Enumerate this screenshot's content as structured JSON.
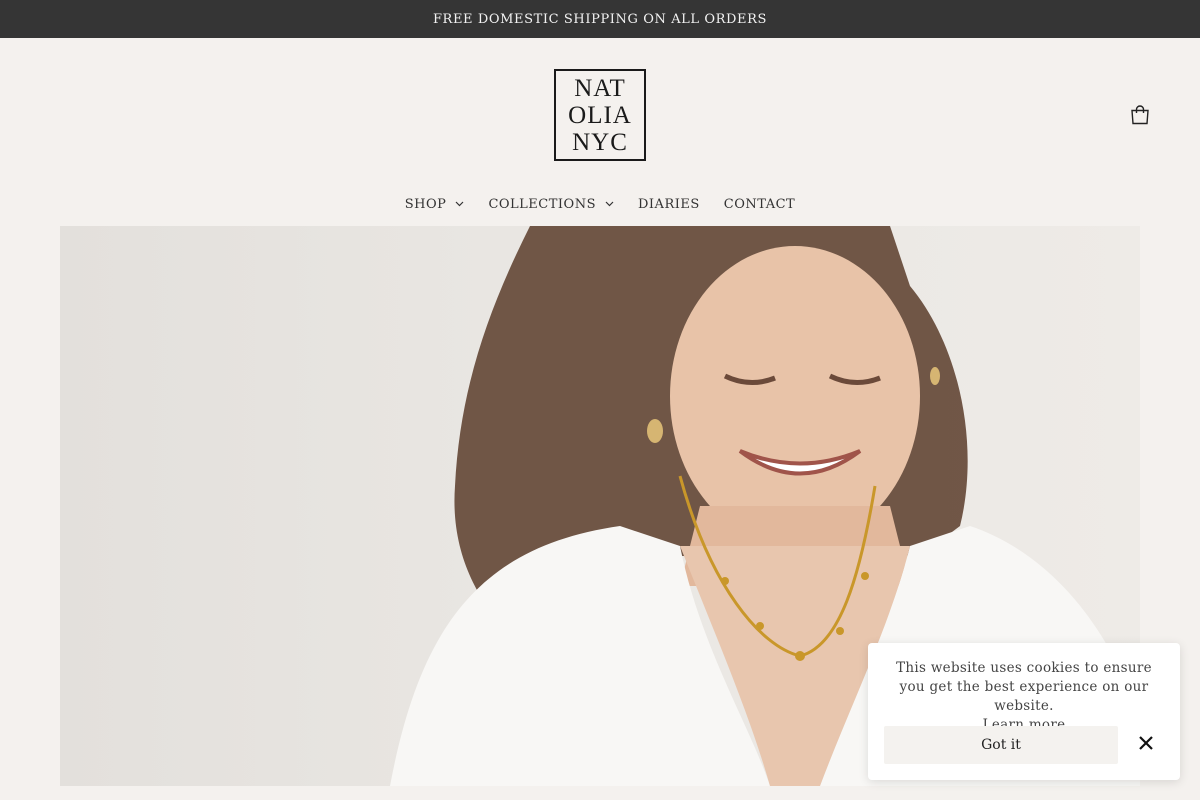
{
  "announcement": {
    "text": "FREE DOMESTIC SHIPPING ON ALL ORDERS"
  },
  "header": {
    "logo_lines": [
      "NAT",
      "OLIA",
      "NYC"
    ],
    "cart_icon": "shopping-bag-icon"
  },
  "nav": {
    "items": [
      {
        "label": "SHOP",
        "has_dropdown": true
      },
      {
        "label": "COLLECTIONS",
        "has_dropdown": true
      },
      {
        "label": "DIARIES",
        "has_dropdown": false
      },
      {
        "label": "CONTACT",
        "has_dropdown": false
      }
    ]
  },
  "cookie": {
    "message": "This website uses cookies to ensure you get the best experience on our website.",
    "learn_more": "Learn more",
    "accept_label": "Got it",
    "close_icon": "close-icon"
  },
  "colors": {
    "announcement_bg": "#353535",
    "page_bg": "#f4f1ee",
    "text": "#222222"
  }
}
